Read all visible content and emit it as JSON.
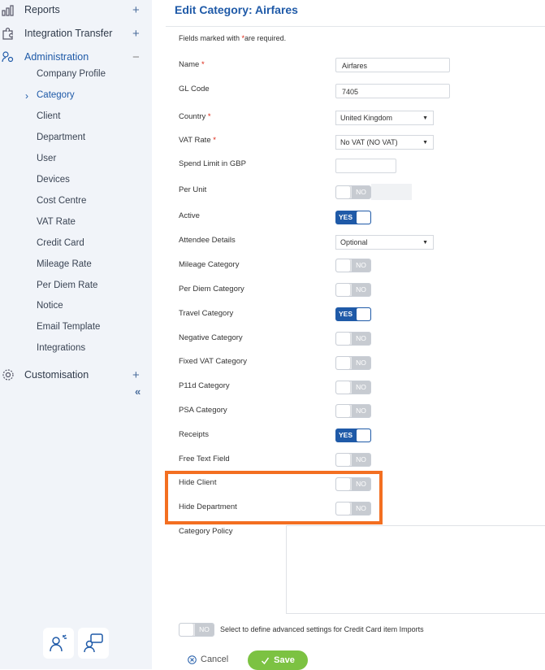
{
  "sidebar": {
    "top_items": [
      {
        "label": "Reports",
        "toggle": "+"
      },
      {
        "label": "Integration Transfer",
        "toggle": "+"
      },
      {
        "label": "Administration",
        "toggle": "−"
      }
    ],
    "admin_items": [
      "Company Profile",
      "Category",
      "Client",
      "Department",
      "User",
      "Devices",
      "Cost Centre",
      "VAT Rate",
      "Credit Card",
      "Mileage Rate",
      "Per Diem Rate",
      "Notice",
      "Email Template",
      "Integrations"
    ],
    "active_item": "Category",
    "customisation": {
      "label": "Customisation",
      "toggle": "+"
    },
    "collapse_glyph": "«"
  },
  "form": {
    "title": "Edit Category: Airfares",
    "required_note_prefix": "Fields marked with ",
    "required_note_suffix": "are required.",
    "name": {
      "label": "Name",
      "value": "Airfares"
    },
    "gl_code": {
      "label": "GL Code",
      "value": "7405"
    },
    "country": {
      "label": "Country",
      "value": "United Kingdom"
    },
    "vat_rate": {
      "label": "VAT Rate",
      "value": "No VAT (NO VAT)"
    },
    "spend_limit": {
      "label": "Spend Limit in GBP",
      "value": ""
    },
    "per_unit": {
      "label": "Per Unit",
      "state": "NO"
    },
    "active": {
      "label": "Active",
      "state": "YES"
    },
    "attendee_details": {
      "label": "Attendee Details",
      "value": "Optional"
    },
    "mileage_category": {
      "label": "Mileage Category",
      "state": "NO"
    },
    "per_diem_category": {
      "label": "Per Diem Category",
      "state": "NO"
    },
    "travel_category": {
      "label": "Travel Category",
      "state": "YES"
    },
    "negative_category": {
      "label": "Negative Category",
      "state": "NO"
    },
    "fixed_vat_category": {
      "label": "Fixed VAT Category",
      "state": "NO"
    },
    "p11d_category": {
      "label": "P11d Category",
      "state": "NO"
    },
    "psa_category": {
      "label": "PSA Category",
      "state": "NO"
    },
    "receipts": {
      "label": "Receipts",
      "state": "YES"
    },
    "free_text_field": {
      "label": "Free Text Field",
      "state": "NO"
    },
    "hide_client": {
      "label": "Hide Client",
      "state": "NO"
    },
    "hide_department": {
      "label": "Hide Department",
      "state": "NO"
    },
    "category_policy": {
      "label": "Category Policy"
    },
    "credit_card_advanced": {
      "state": "NO",
      "text": "Select to define advanced settings for Credit Card item Imports"
    },
    "cancel_label": "Cancel",
    "save_label": "Save"
  },
  "colors": {
    "accent": "#1f5aa8",
    "highlight": "#f36f21",
    "save": "#7cc242",
    "sidebar_bg": "#f1f4f9"
  }
}
